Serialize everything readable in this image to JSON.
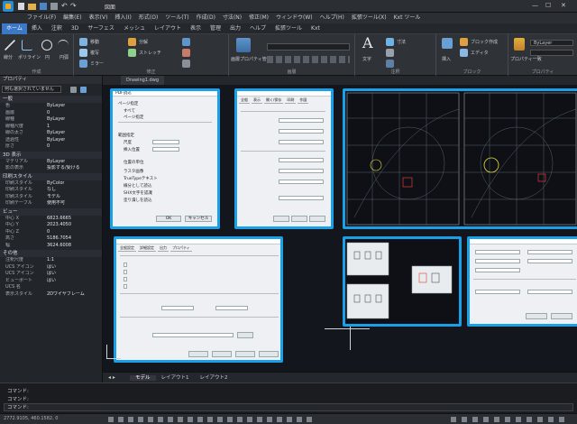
{
  "title_bar": {
    "file_name": "図面"
  },
  "menu": [
    "ファイル(F)",
    "編集(E)",
    "表示(V)",
    "挿入(I)",
    "形式(O)",
    "ツール(T)",
    "作成(D)",
    "寸法(N)",
    "修正(M)",
    "ウィンドウ(W)",
    "ヘルプ(H)",
    "拡張ツール(X)",
    "Kxt ツール"
  ],
  "ribbon_tabs": [
    "ホーム",
    "挿入",
    "注釈",
    "3D",
    "サーフェス",
    "メッシュ",
    "レイアウト",
    "表示",
    "管理",
    "出力",
    "ヘルプ",
    "拡張ツール",
    "Kxt"
  ],
  "active_ribbon_tab": "ホーム",
  "ribbon_groups": [
    {
      "label": "作成",
      "buttons": [
        "線分",
        "ポリライン",
        "円",
        "円弧"
      ]
    },
    {
      "label": "修正",
      "buttons": [
        "移動",
        "複写",
        "ミラー",
        "分解",
        "ストレッチ"
      ]
    },
    {
      "label": "画層",
      "buttons": [
        "画層プロパティ管理"
      ]
    },
    {
      "label": "注釈",
      "buttons": [
        "文字",
        "寸法"
      ]
    },
    {
      "label": "ブロック",
      "buttons": [
        "挿入",
        "ブロック作成",
        "エディタ"
      ]
    },
    {
      "label": "プロパティ",
      "buttons": [
        "プロパティ一致",
        "ByLayer"
      ]
    }
  ],
  "properties_panel": {
    "header": "プロパティ",
    "selector": "何も選択されていません",
    "sections": [
      {
        "title": "一般",
        "rows": [
          [
            "色",
            "ByLayer"
          ],
          [
            "画層",
            "0"
          ],
          [
            "線種",
            "ByLayer"
          ],
          [
            "線種尺度",
            "1"
          ],
          [
            "線の太さ",
            "ByLayer"
          ],
          [
            "透過性",
            "ByLayer"
          ],
          [
            "厚さ",
            "0"
          ]
        ]
      },
      {
        "title": "3D 表示",
        "rows": [
          [
            "マテリアル",
            "ByLayer"
          ],
          [
            "影の表示",
            "投影する/受ける"
          ]
        ]
      },
      {
        "title": "印刷スタイル",
        "rows": [
          [
            "印刷スタイル",
            "ByColor"
          ],
          [
            "印刷スタイル",
            "なし"
          ],
          [
            "印刷スタイル",
            "モデル"
          ],
          [
            "印刷テーブル",
            "使用不可"
          ]
        ]
      },
      {
        "title": "ビュー",
        "rows": [
          [
            "中心 X",
            "6823.6665"
          ],
          [
            "中心 Y",
            "2023.4050"
          ],
          [
            "中心 Z",
            "0"
          ],
          [
            "高さ",
            "5186.7054"
          ],
          [
            "幅",
            "3624.6008"
          ]
        ]
      },
      {
        "title": "その他",
        "rows": [
          [
            "注釈尺度",
            "1:1"
          ],
          [
            "UCS アイコン",
            "はい"
          ],
          [
            "UCS アイコン",
            "はい"
          ],
          [
            "ビューポート",
            "はい"
          ],
          [
            "UCS 名",
            ""
          ],
          [
            "表示スタイル",
            "2Dワイヤフレーム"
          ]
        ]
      }
    ]
  },
  "doc_tab": "Drawing1.dwg",
  "layout_tabs": [
    "モデル",
    "レイアウト1",
    "レイアウト2"
  ],
  "dialogs": {
    "pdf": {
      "title": "PDF読込",
      "page_label": "ページ指定",
      "radio_all": "すべて",
      "radio_range": "ページ指定",
      "range_label": "範囲指定",
      "scale_label": "尺度",
      "pos_label": "挿入位置",
      "unit_label": "位置の単位",
      "opt1": "ラスタ画像",
      "opt2": "TrueTypeテキスト",
      "opt3": "線分として読込",
      "opt4": "SHX文字を認識",
      "opt5": "塗り潰しを読込",
      "ok": "OK",
      "cancel": "キャンセル"
    },
    "settings_tabs": [
      "全般",
      "表示",
      "開く/保存",
      "印刷",
      "作図"
    ],
    "export_tabs": [
      "全般設定",
      "詳細設定",
      "出力",
      "プロパティ"
    ]
  },
  "command_line": {
    "line1": "コマンド:",
    "line2": "コマンド:",
    "prompt": "コマンド:"
  },
  "status": {
    "coords": "2772.9105, 460.1582, 0"
  },
  "colors": {
    "accent": "#1aa0e8",
    "ribbon_active": "#3b78c7",
    "canvas": "#14161d"
  }
}
